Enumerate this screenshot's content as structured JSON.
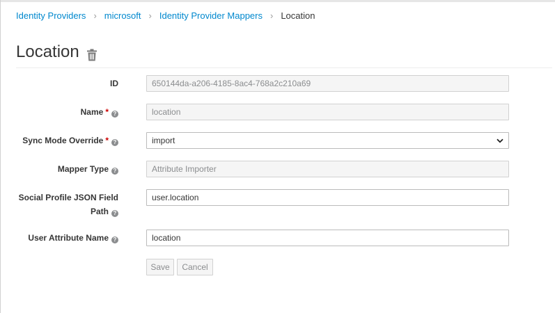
{
  "breadcrumb": {
    "items": [
      "Identity Providers",
      "microsoft",
      "Identity Provider Mappers"
    ],
    "current": "Location",
    "separator": "›"
  },
  "page": {
    "title": "Location",
    "delete_icon": "trash-icon"
  },
  "form": {
    "id": {
      "label": "ID",
      "value": "650144da-a206-4185-8ac4-768a2c210a69"
    },
    "name": {
      "label": "Name",
      "required_mark": "*",
      "value": "location"
    },
    "sync_mode": {
      "label": "Sync Mode Override",
      "required_mark": "*",
      "value": "import"
    },
    "mapper_type": {
      "label": "Mapper Type",
      "value": "Attribute Importer"
    },
    "json_path": {
      "label_line1": "Social Profile JSON Field",
      "label_line2": "Path",
      "value": "user.location"
    },
    "user_attribute": {
      "label": "User Attribute Name",
      "value": "location"
    }
  },
  "actions": {
    "save": "Save",
    "cancel": "Cancel"
  },
  "help_glyph": "?",
  "colors": {
    "link": "#0088ce",
    "required": "#cc0000",
    "text": "#363636"
  }
}
